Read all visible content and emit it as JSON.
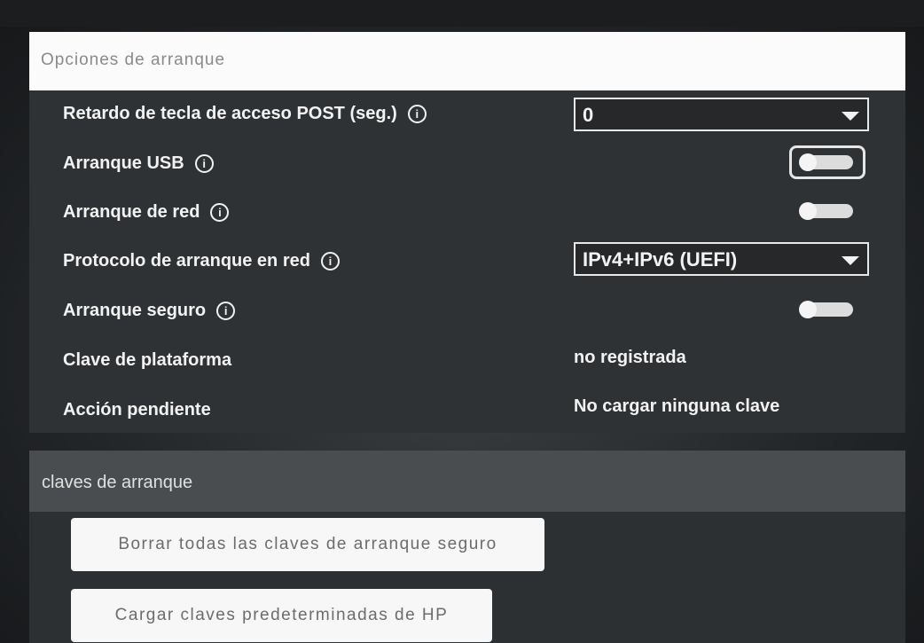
{
  "boot_options": {
    "title": "Opciones de arranque",
    "post_delay": {
      "label": "Retardo de tecla de acceso POST (seg.)",
      "value": "0"
    },
    "usb_boot": {
      "label": "Arranque USB",
      "enabled": false
    },
    "network_boot": {
      "label": "Arranque de red",
      "enabled": false
    },
    "network_protocol": {
      "label": "Protocolo de arranque en red",
      "value": "IPv4+IPv6 (UEFI)"
    },
    "secure_boot": {
      "label": "Arranque seguro",
      "enabled": false
    },
    "platform_key": {
      "label": "Clave de plataforma",
      "value": "no registrada"
    },
    "pending_action": {
      "label": "Acción pendiente",
      "value": "No cargar ninguna clave"
    },
    "info_glyph": "i"
  },
  "boot_keys": {
    "title": "claves de arranque",
    "clear_button": "Borrar todas las claves de arranque seguro",
    "load_button": "Cargar claves predeterminadas de HP"
  }
}
